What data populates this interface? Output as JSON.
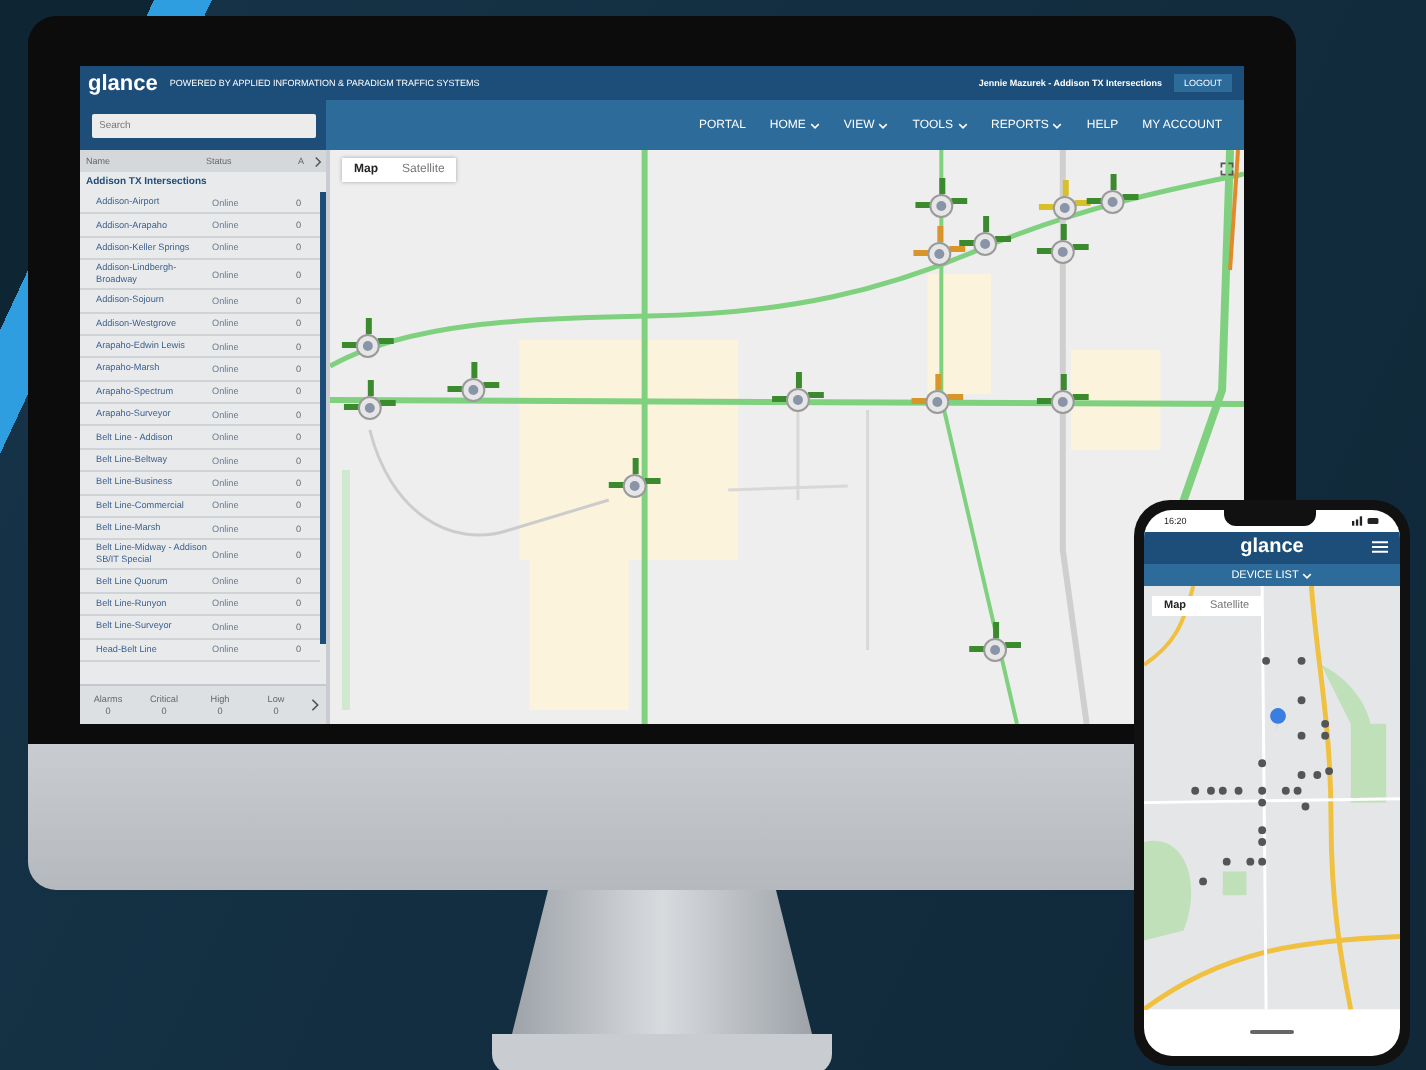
{
  "header": {
    "logo": "glance",
    "tagline": "POWERED BY APPLIED INFORMATION & PARADIGM TRAFFIC SYSTEMS",
    "user": "Jennie Mazurek - Addison TX Intersections",
    "logout": "LOGOUT"
  },
  "nav": {
    "search": {
      "placeholder": "Search"
    },
    "items": [
      {
        "label": "PORTAL",
        "dropdown": false
      },
      {
        "label": "HOME",
        "dropdown": true
      },
      {
        "label": "VIEW",
        "dropdown": true
      },
      {
        "label": "TOOLS",
        "dropdown": true
      },
      {
        "label": "REPORTS",
        "dropdown": true
      },
      {
        "label": "HELP",
        "dropdown": false
      },
      {
        "label": "MY ACCOUNT",
        "dropdown": false
      }
    ]
  },
  "sidebar": {
    "columns": [
      "Name",
      "Status",
      "A"
    ],
    "group": "Addison TX Intersections",
    "rows": [
      {
        "name": "Addison-Airport",
        "status": "Online",
        "count": "0"
      },
      {
        "name": "Addison-Arapaho",
        "status": "Online",
        "count": "0"
      },
      {
        "name": "Addison-Keller Springs",
        "status": "Online",
        "count": "0"
      },
      {
        "name": "Addison-Lindbergh-Broadway",
        "status": "Online",
        "count": "0"
      },
      {
        "name": "Addison-Sojourn",
        "status": "Online",
        "count": "0"
      },
      {
        "name": "Addison-Westgrove",
        "status": "Online",
        "count": "0"
      },
      {
        "name": "Arapaho-Edwin Lewis",
        "status": "Online",
        "count": "0"
      },
      {
        "name": "Arapaho-Marsh",
        "status": "Online",
        "count": "0"
      },
      {
        "name": "Arapaho-Spectrum",
        "status": "Online",
        "count": "0"
      },
      {
        "name": "Arapaho-Surveyor",
        "status": "Online",
        "count": "0"
      },
      {
        "name": "Belt Line - Addison",
        "status": "Online",
        "count": "0"
      },
      {
        "name": "Belt Line-Beltway",
        "status": "Online",
        "count": "0"
      },
      {
        "name": "Belt Line-Business",
        "status": "Online",
        "count": "0"
      },
      {
        "name": "Belt Line-Commercial",
        "status": "Online",
        "count": "0"
      },
      {
        "name": "Belt Line-Marsh",
        "status": "Online",
        "count": "0"
      },
      {
        "name": "Belt Line-Midway - Addison SB/IT Special",
        "status": "Online",
        "count": "0"
      },
      {
        "name": "Belt Line Quorum",
        "status": "Online",
        "count": "0"
      },
      {
        "name": "Belt Line-Runyon",
        "status": "Online",
        "count": "0"
      },
      {
        "name": "Belt Line-Surveyor",
        "status": "Online",
        "count": "0"
      },
      {
        "name": "Head-Belt Line",
        "status": "Online",
        "count": "0"
      }
    ],
    "summary": [
      {
        "label": "Alarms",
        "value": "0"
      },
      {
        "label": "Critical",
        "value": "0"
      },
      {
        "label": "High",
        "value": "0"
      },
      {
        "label": "Low",
        "value": "0"
      }
    ]
  },
  "map": {
    "tabs": [
      {
        "label": "Map",
        "selected": true
      },
      {
        "label": "Satellite",
        "selected": false
      }
    ]
  },
  "phone": {
    "time": "16:20",
    "logo": "glance",
    "title": "DEVICE LIST",
    "tabs": [
      {
        "label": "Map",
        "selected": true
      },
      {
        "label": "Satellite",
        "selected": false
      }
    ]
  }
}
